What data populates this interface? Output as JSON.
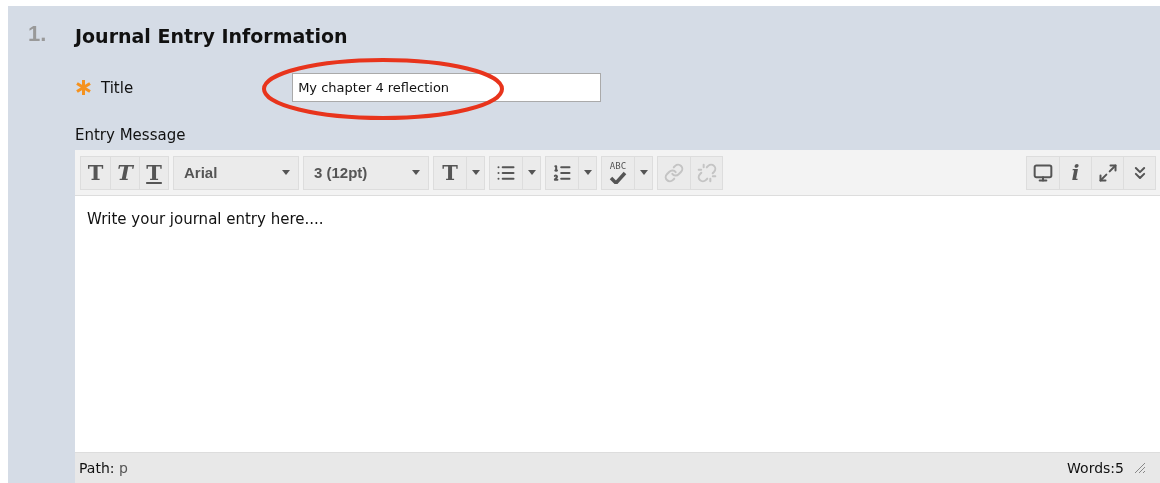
{
  "section": {
    "number": "1.",
    "title": "Journal Entry Information"
  },
  "title_field": {
    "label": "Title",
    "required": true,
    "value": "My chapter 4 reflection",
    "annotated": true
  },
  "entry_message": {
    "label": "Entry Message",
    "toolbar": {
      "format_glyphs": [
        "T",
        "T",
        "T"
      ],
      "font": "Arial",
      "size": "3 (12pt)",
      "color_glyph": "T",
      "spellcheck_glyph": "ABC",
      "link_buttons": [
        {
          "disabled": true
        },
        {
          "disabled": true
        }
      ],
      "info_glyph": "i"
    },
    "content": "Write your journal entry here....",
    "status": {
      "path_label": "Path:",
      "path": "p",
      "words": "Words:5"
    }
  }
}
